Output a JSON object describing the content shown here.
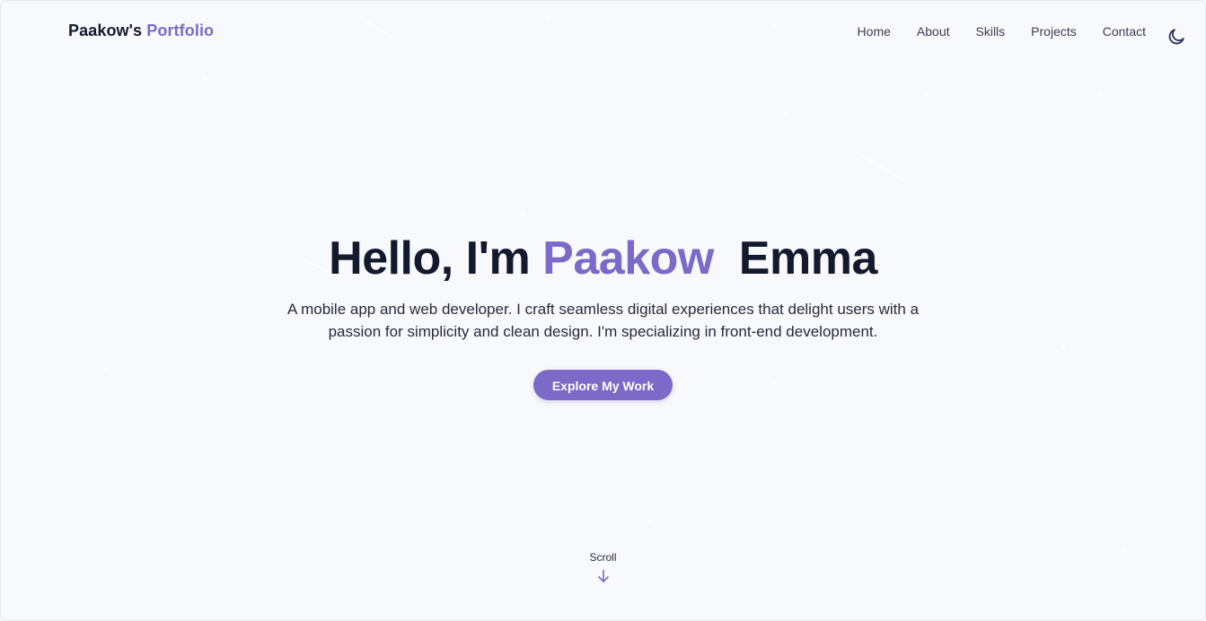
{
  "brand": {
    "name": "Paakow's",
    "accent": "Portfolio"
  },
  "nav": {
    "items": [
      {
        "label": "Home"
      },
      {
        "label": "About"
      },
      {
        "label": "Skills"
      },
      {
        "label": "Projects"
      },
      {
        "label": "Contact"
      }
    ],
    "theme_toggle_icon": "moon-icon"
  },
  "hero": {
    "greeting": "Hello, I'm",
    "first_name": "Paakow",
    "last_name": "Emma",
    "description": "A mobile app and web developer. I craft seamless digital experiences that delight users with a passion for simplicity and clean design. I'm specializing in front-end development.",
    "cta_label": "Explore My Work"
  },
  "scroll": {
    "label": "Scroll",
    "icon": "arrow-down-icon"
  },
  "colors": {
    "accent": "#7c6ac9",
    "background": "#f8f9fc",
    "text": "#131a2e"
  }
}
